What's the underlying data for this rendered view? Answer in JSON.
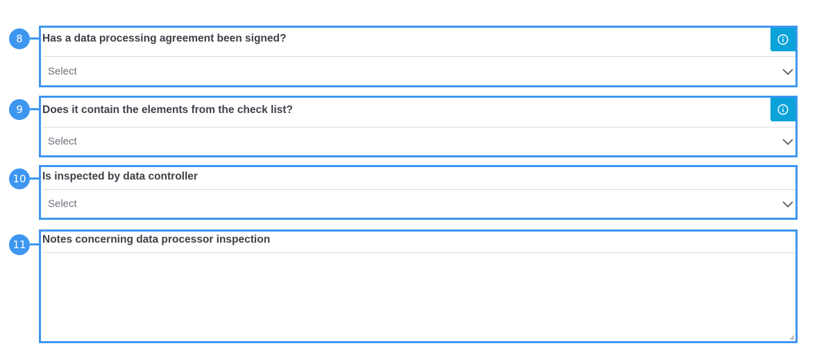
{
  "accent_color": "#3d96f0",
  "info_color": "#0aa2d9",
  "fields": [
    {
      "number": "8",
      "label": "Has a data processing agreement been signed?",
      "placeholder": "Select",
      "icon": "info-icon"
    },
    {
      "number": "9",
      "label": "Does it contain the elements from the check list?",
      "placeholder": "Select",
      "icon": "info-icon"
    },
    {
      "number": "10",
      "label": "Is inspected by data controller",
      "placeholder": "Select"
    },
    {
      "number": "11",
      "label": "Notes concerning data processor inspection",
      "value": ""
    }
  ]
}
